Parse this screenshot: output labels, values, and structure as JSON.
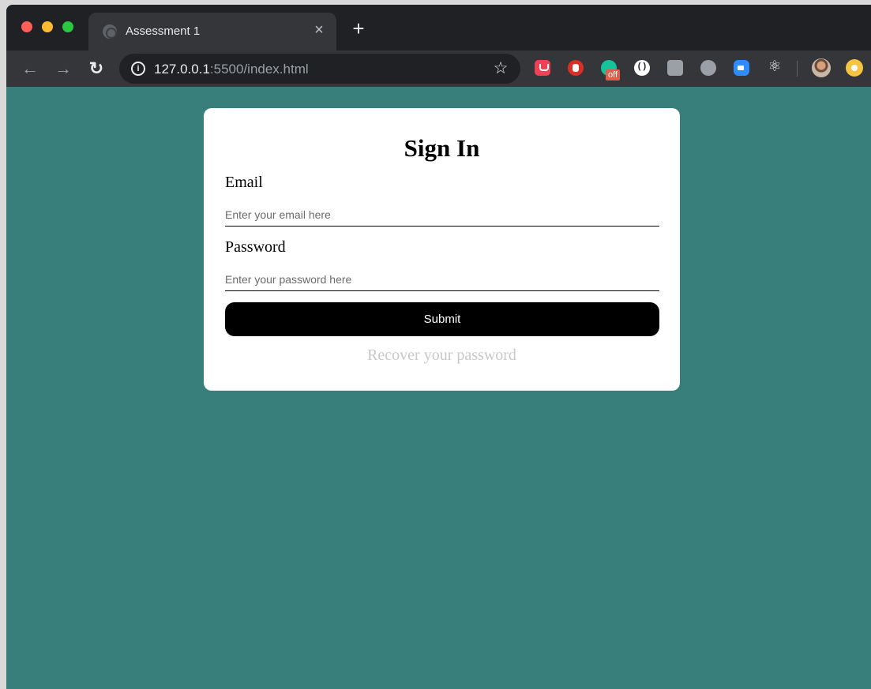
{
  "browser": {
    "tab_title": "Assessment 1",
    "tab_close": "×",
    "new_tab": "+",
    "url_host": "127.0.0.1",
    "url_rest": ":5500/index.html",
    "grammarly_badge": "off",
    "icons": [
      "back-icon",
      "forward-icon",
      "reload-icon",
      "info-icon",
      "star-icon",
      "pocket-icon",
      "adblock-icon",
      "grammarly-icon",
      "braces-icon",
      "rune-icon",
      "chat-icon",
      "zoom-icon",
      "react-icon",
      "avatar",
      "smile-icon"
    ]
  },
  "form": {
    "title": "Sign In",
    "email_label": "Email",
    "email_placeholder": "Enter your email here",
    "password_label": "Password",
    "password_placeholder": "Enter your password here",
    "submit_label": "Submit",
    "recover_link": "Recover your password"
  },
  "colors": {
    "page_background": "#387f7c",
    "card": "#ffffff",
    "button": "#000000",
    "recover_link": "#c8c8c8"
  }
}
